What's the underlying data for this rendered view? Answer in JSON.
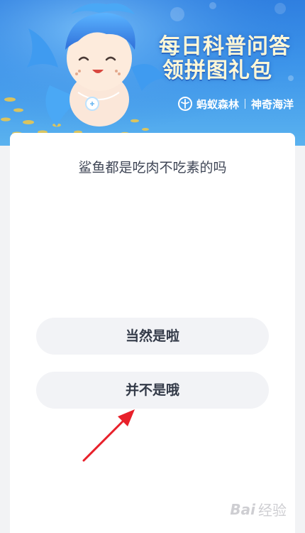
{
  "banner": {
    "title_line1": "每日科普问答",
    "title_line2": "领拼图礼包",
    "brand_name": "蚂蚁森林",
    "sub_brand": "神奇海洋",
    "colors": {
      "sky": "#2f7fe0",
      "title": "#fff7d6"
    }
  },
  "quiz": {
    "question": "鲨鱼都是吃肉不吃素的吗",
    "options": [
      {
        "label": "当然是啦"
      },
      {
        "label": "并不是哦"
      }
    ]
  },
  "annotation": {
    "arrow_color": "#e8202a",
    "points_to": "option-2"
  },
  "watermark": {
    "logo": "Bai",
    "text": "经验"
  }
}
